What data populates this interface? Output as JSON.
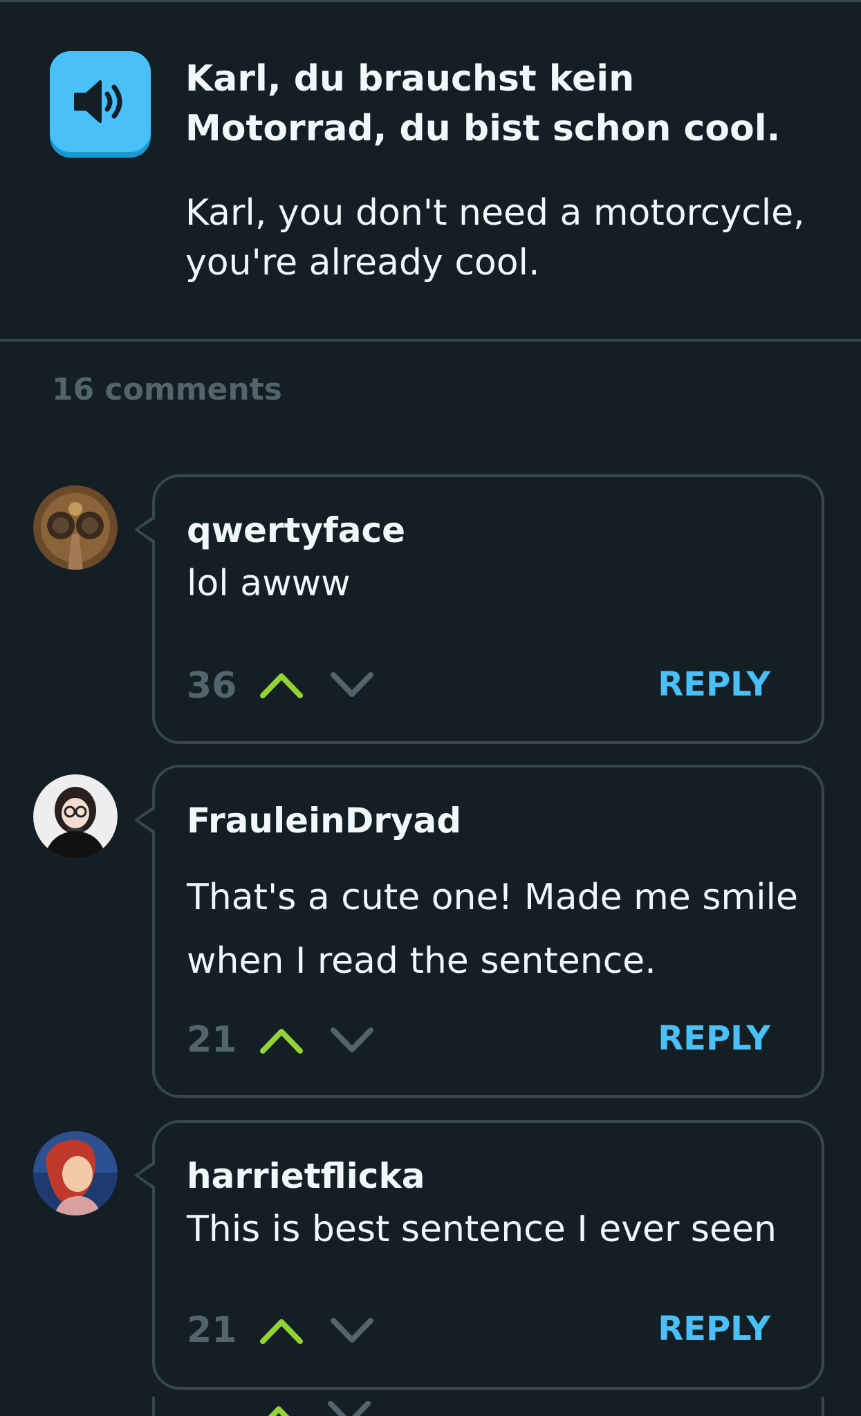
{
  "sentence": {
    "german": "Karl, du brauchst kein Motorrad, du bist schon cool.",
    "english": "Karl, you don't need a motorcycle, you're already cool.",
    "speaker_icon": "speaker-icon"
  },
  "comments_header": {
    "count_label": "16 comments"
  },
  "comments": [
    {
      "username": "qwertyface",
      "text": "lol awww",
      "votes": "36",
      "reply_label": "REPLY",
      "avatar": "insect-closeup"
    },
    {
      "username": "FrauleinDryad",
      "text": "That's a cute one! Made me smile when I read the sentence.",
      "votes": "21",
      "reply_label": "REPLY",
      "avatar": "cartoon-girl-glasses"
    },
    {
      "username": "harrietflicka",
      "text": "This is best sentence I ever seen",
      "votes": "21",
      "reply_label": "REPLY",
      "avatar": "cartoon-mermaid"
    }
  ],
  "colors": {
    "background": "#131f24",
    "border": "#37464f",
    "muted_text": "#52656d",
    "accent_blue": "#49c0f8",
    "upvote_green": "#93d333",
    "downvote_gray": "#52656d"
  }
}
